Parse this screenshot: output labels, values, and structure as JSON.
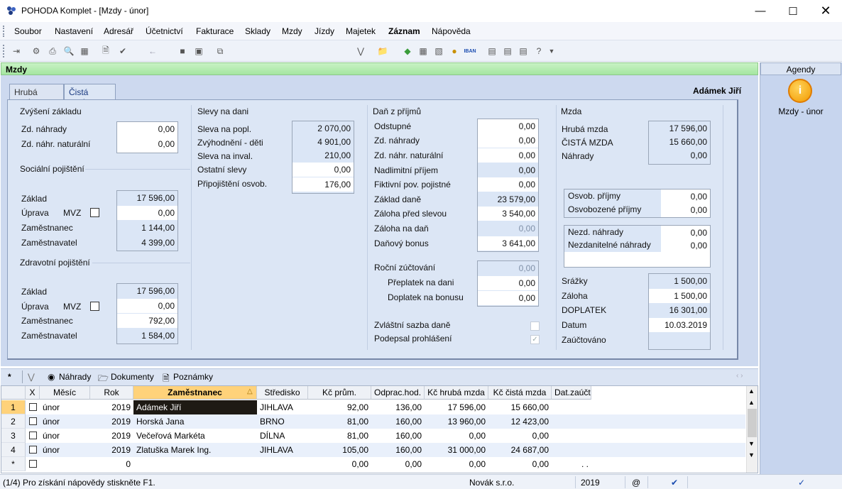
{
  "window": {
    "title": "POHODA Komplet - [Mzdy - únor]"
  },
  "menu": [
    "Soubor",
    "Nastavení",
    "Adresář",
    "Účetnictví",
    "Fakturace",
    "Sklady",
    "Mzdy",
    "Jízdy",
    "Majetek",
    "Záznam",
    "Nápověda"
  ],
  "panel_title": "Mzdy",
  "tabs": {
    "gross": "Hrubá mzda",
    "net": "Čistá mzda"
  },
  "employee_name": "Adámek Jiří",
  "zvyseni": {
    "title": "Zvýšení základu",
    "zd_nahrady": "Zd. náhrady",
    "zd_nahrady_val": "0,00",
    "zd_nahr_nat": "Zd. náhr. naturální",
    "zd_nahr_nat_val": "0,00"
  },
  "socialni": {
    "title": "Sociální pojištění",
    "zaklad": "Základ",
    "zaklad_val": "17 596,00",
    "uprava": "Úprava",
    "mvz": "MVZ",
    "uprava_val": "0,00",
    "zamestnanec": "Zaměstnanec",
    "zamestnanec_val": "1 144,00",
    "zamestnavatel": "Zaměstnavatel",
    "zamestnavatel_val": "4 399,00"
  },
  "zdravotni": {
    "title": "Zdravotní pojištění",
    "zaklad": "Základ",
    "zaklad_val": "17 596,00",
    "uprava": "Úprava",
    "mvz": "MVZ",
    "uprava_val": "0,00",
    "zamestnanec": "Zaměstnanec",
    "zamestnanec_val": "792,00",
    "zamestnavatel": "Zaměstnavatel",
    "zamestnavatel_val": "1 584,00"
  },
  "slevy": {
    "title": "Slevy na dani",
    "popl": "Sleva na popl.",
    "popl_val": "2 070,00",
    "deti": "Zvýhodnění - děti",
    "deti_val": "4 901,00",
    "inval": "Sleva na inval.",
    "inval_val": "210,00",
    "ostatni": "Ostatní slevy",
    "ostatni_val": "0,00",
    "pripojisteni": "Připojištění osvob.",
    "pripojisteni_val": "176,00"
  },
  "dan": {
    "title": "Daň z příjmů",
    "odstupne": "Odstupné",
    "odstupne_val": "0,00",
    "zd_nahrady": "Zd. náhrady",
    "zd_nahrady_val": "0,00",
    "zd_nahr_nat": "Zd. náhr. naturální",
    "zd_nahr_nat_val": "0,00",
    "nadlimitni": "Nadlimitní příjem",
    "nadlimitni_val": "0,00",
    "fiktivni": "Fiktivní pov. pojistné",
    "fiktivni_val": "0,00",
    "zaklad": "Základ daně",
    "zaklad_val": "23 579,00",
    "zaloha_pred": "Záloha před slevou",
    "zaloha_pred_val": "3 540,00",
    "zaloha_dan": "Záloha na daň",
    "zaloha_dan_val": "0,00",
    "bonus": "Daňový bonus",
    "bonus_val": "3 641,00",
    "rocni": "Roční zúčtování",
    "rocni_val": "0,00",
    "preplatek": "Přeplatek na dani",
    "preplatek_val": "0,00",
    "doplatek": "Doplatek na bonusu",
    "doplatek_val": "0,00",
    "zvlastni": "Zvláštní sazba daně",
    "podepsal": "Podepsal prohlášení"
  },
  "mzda": {
    "title": "Mzda",
    "hruba": "Hrubá mzda",
    "hruba_val": "17 596,00",
    "cista": "ČISTÁ MZDA",
    "cista_val": "15 660,00",
    "nahrady": "Náhrady",
    "nahrady_val": "0,00",
    "osvob": "Osvob. příjmy",
    "osvob_val": "0,00",
    "osvobozene": "Osvobozené příjmy",
    "osvobozene_val": "0,00",
    "nezd": "Nezd. náhrady",
    "nezd_val": "0,00",
    "nezdanitelne": "Nezdanitelné náhrady",
    "nezdanitelne_val": "0,00",
    "srazky": "Srážky",
    "srazky_val": "1 500,00",
    "zaloha": "Záloha",
    "zaloha_val": "1 500,00",
    "doplatek": "DOPLATEK",
    "doplatek_val": "16 301,00",
    "datum": "Datum",
    "datum_val": "10.03.2019",
    "zauctovano": "Zaúčtováno"
  },
  "agendy": {
    "header": "Agendy",
    "item": "Mzdy - únor"
  },
  "bottom_tabs": {
    "star": "*",
    "nahrady": "Náhrady",
    "dokumenty": "Dokumenty",
    "poznamky": "Poznámky"
  },
  "grid": {
    "columns": [
      "X",
      "Měsíc",
      "Rok",
      "Zaměstnanec",
      "Středisko",
      "Kč prům.",
      "Odprac.hod.",
      "Kč hrubá mzda",
      "Kč čistá mzda",
      "Dat.zaúčt."
    ],
    "rows": [
      {
        "n": "1",
        "mesic": "únor",
        "rok": "2019",
        "zam": "Adámek Jiří",
        "str": "JIHLAVA",
        "prum": "92,00",
        "hod": "136,00",
        "hruba": "17 596,00",
        "cista": "15 660,00",
        "dat": ""
      },
      {
        "n": "2",
        "mesic": "únor",
        "rok": "2019",
        "zam": "Horská Jana",
        "str": "BRNO",
        "prum": "81,00",
        "hod": "160,00",
        "hruba": "13 960,00",
        "cista": "12 423,00",
        "dat": ""
      },
      {
        "n": "3",
        "mesic": "únor",
        "rok": "2019",
        "zam": "Večeřová Markéta",
        "str": "DÍLNA",
        "prum": "81,00",
        "hod": "160,00",
        "hruba": "0,00",
        "cista": "0,00",
        "dat": ""
      },
      {
        "n": "4",
        "mesic": "únor",
        "rok": "2019",
        "zam": "Zlatuška Marek Ing.",
        "str": "JIHLAVA",
        "prum": "105,00",
        "hod": "160,00",
        "hruba": "31 000,00",
        "cista": "24 687,00",
        "dat": ""
      },
      {
        "n": "*",
        "mesic": "",
        "rok": "0",
        "zam": "",
        "str": "",
        "prum": "0,00",
        "hod": "0,00",
        "hruba": "0,00",
        "cista": "0,00",
        "dat": ". ."
      }
    ]
  },
  "status": {
    "help": "(1/4) Pro získání nápovědy stiskněte F1.",
    "company": "Novák s.r.o.",
    "year": "2019",
    "at": "@"
  },
  "colors": {
    "panel_header": "#a4e6a0",
    "selected_cell": "#1e1a14",
    "sorted_header": "#ffd27a"
  }
}
